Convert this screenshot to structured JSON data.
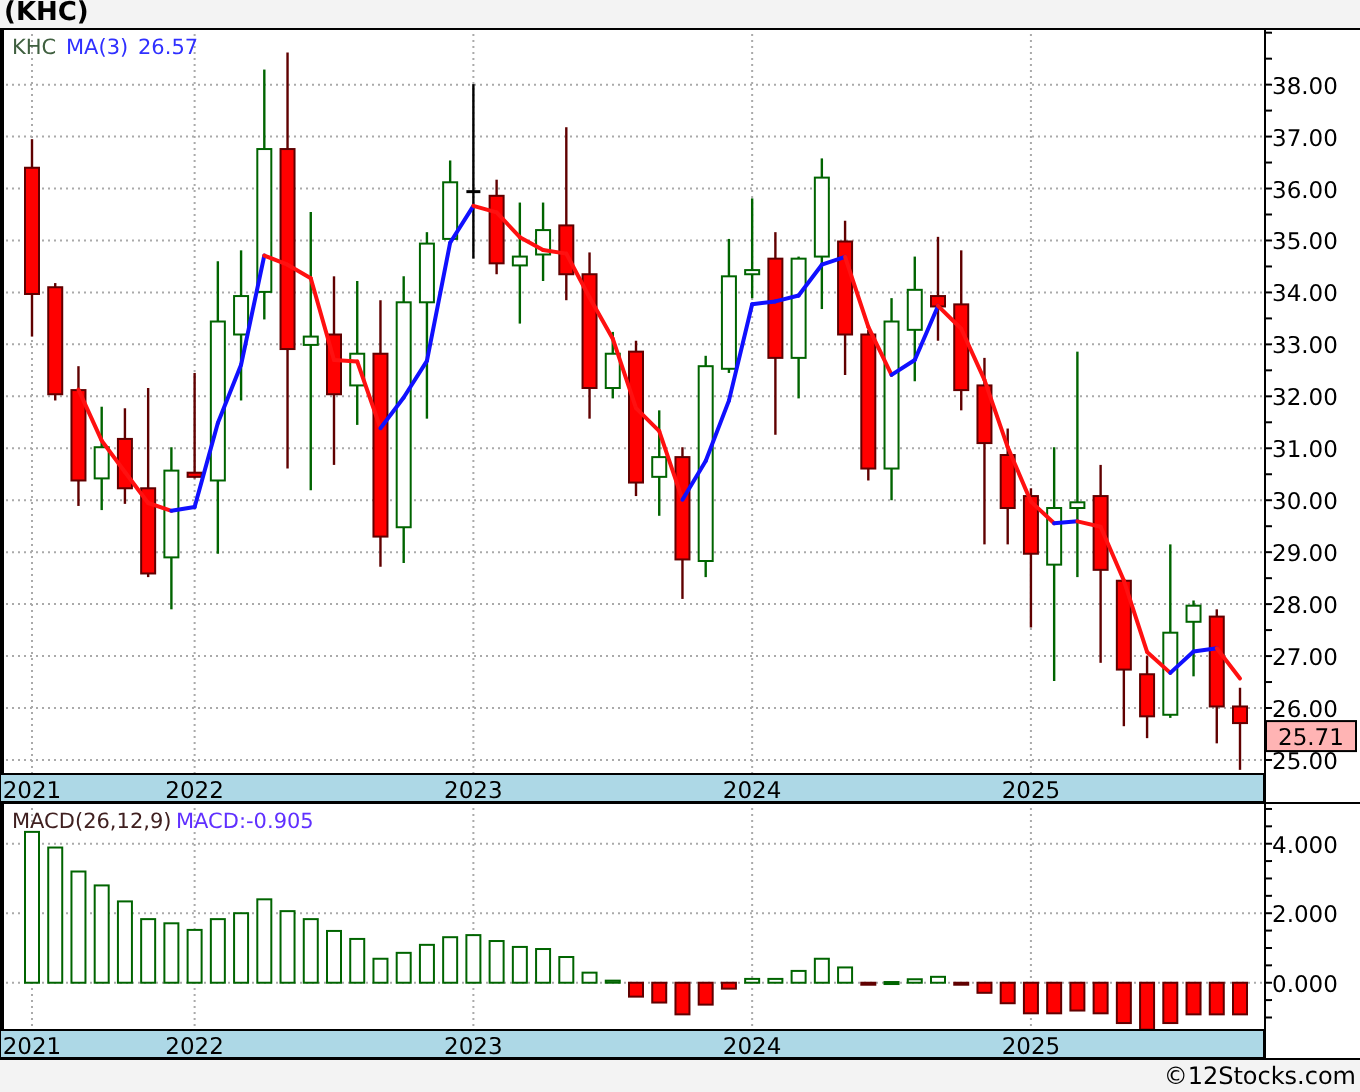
{
  "title": "(KHC)",
  "price_chart": {
    "legend": {
      "symbol": "KHC",
      "indicator": "MA(3)",
      "value": "26.57"
    },
    "last_price": "25.71",
    "chart_data": {
      "type": "candlestick",
      "ylim": [
        24.73,
        39.09
      ],
      "grid": true,
      "categories": [
        "2021",
        null,
        null,
        null,
        null,
        null,
        null,
        "2022",
        null,
        null,
        null,
        null,
        null,
        null,
        null,
        null,
        null,
        null,
        null,
        "2023",
        null,
        null,
        null,
        null,
        null,
        null,
        null,
        null,
        null,
        null,
        null,
        "2024",
        null,
        null,
        null,
        null,
        null,
        null,
        null,
        null,
        null,
        null,
        null,
        "2025",
        null,
        null,
        null,
        null,
        null,
        null,
        null,
        null,
        null
      ],
      "yticks": [
        {
          "value": 25,
          "label": "25.00"
        },
        {
          "value": 26,
          "label": "26.00"
        },
        {
          "value": 27,
          "label": "27.00"
        },
        {
          "value": 28,
          "label": "28.00"
        },
        {
          "value": 29,
          "label": "29.00"
        },
        {
          "value": 30,
          "label": "30.00"
        },
        {
          "value": 31,
          "label": "31.00"
        },
        {
          "value": 32,
          "label": "32.00"
        },
        {
          "value": 33,
          "label": "33.00"
        },
        {
          "value": 34,
          "label": "34.00"
        },
        {
          "value": 35,
          "label": "35.00"
        },
        {
          "value": 36,
          "label": "36.00"
        },
        {
          "value": 37,
          "label": "37.00"
        },
        {
          "value": 38,
          "label": "38.00"
        }
      ],
      "ohlc": [
        [
          36.4,
          36.95,
          33.15,
          33.97
        ],
        [
          34.1,
          34.18,
          31.92,
          32.04
        ],
        [
          32.12,
          32.58,
          29.89,
          30.38
        ],
        [
          30.42,
          31.8,
          29.81,
          31.02
        ],
        [
          31.18,
          31.77,
          29.93,
          30.23
        ],
        [
          30.23,
          32.16,
          28.52,
          28.59
        ],
        [
          28.9,
          31.02,
          27.9,
          30.57
        ],
        [
          30.53,
          32.45,
          30.42,
          30.45
        ],
        [
          30.38,
          34.6,
          28.97,
          33.44
        ],
        [
          33.19,
          34.81,
          31.92,
          33.93
        ],
        [
          34.01,
          38.29,
          33.48,
          36.76
        ],
        [
          36.76,
          38.62,
          30.61,
          32.91
        ],
        [
          32.99,
          35.55,
          30.19,
          33.15
        ],
        [
          33.19,
          34.31,
          30.68,
          32.04
        ],
        [
          32.21,
          34.22,
          31.45,
          32.82
        ],
        [
          32.82,
          33.85,
          28.72,
          29.3
        ],
        [
          29.48,
          34.31,
          28.79,
          33.81
        ],
        [
          33.81,
          35.16,
          31.57,
          34.94
        ],
        [
          35.03,
          36.54,
          35.03,
          36.12
        ],
        [
          35.94,
          38.01,
          34.65,
          35.94
        ],
        [
          35.86,
          36.17,
          34.35,
          34.56
        ],
        [
          34.52,
          35.73,
          33.4,
          34.69
        ],
        [
          34.73,
          35.73,
          34.22,
          35.2
        ],
        [
          35.29,
          37.18,
          33.85,
          34.35
        ],
        [
          34.35,
          34.77,
          31.57,
          32.16
        ],
        [
          32.16,
          33.24,
          31.96,
          32.82
        ],
        [
          32.86,
          33.07,
          30.08,
          30.34
        ],
        [
          30.45,
          31.73,
          29.7,
          30.83
        ],
        [
          30.83,
          31.02,
          28.1,
          28.86
        ],
        [
          28.83,
          32.78,
          28.52,
          32.58
        ],
        [
          32.53,
          35.03,
          32.45,
          34.31
        ],
        [
          34.35,
          35.81,
          33.89,
          34.43
        ],
        [
          34.65,
          35.16,
          31.26,
          32.74
        ],
        [
          32.74,
          34.69,
          31.96,
          34.65
        ],
        [
          34.69,
          36.58,
          33.68,
          36.21
        ],
        [
          34.98,
          35.38,
          32.41,
          33.19
        ],
        [
          33.19,
          33.28,
          30.38,
          30.61
        ],
        [
          30.61,
          33.89,
          30.0,
          33.44
        ],
        [
          33.28,
          34.69,
          32.29,
          34.05
        ],
        [
          33.93,
          35.07,
          33.07,
          33.73
        ],
        [
          33.77,
          34.81,
          31.73,
          32.12
        ],
        [
          32.21,
          32.74,
          29.15,
          31.1
        ],
        [
          30.87,
          31.38,
          29.15,
          29.85
        ],
        [
          30.08,
          30.23,
          27.55,
          28.97
        ],
        [
          28.76,
          31.02,
          26.52,
          29.85
        ],
        [
          29.85,
          32.86,
          28.52,
          29.96
        ],
        [
          30.08,
          30.68,
          26.87,
          28.66
        ],
        [
          28.45,
          28.45,
          25.65,
          26.74
        ],
        [
          26.65,
          27.0,
          25.42,
          25.84
        ],
        [
          25.87,
          29.15,
          25.81,
          27.45
        ],
        [
          27.66,
          28.07,
          26.61,
          27.97
        ],
        [
          27.76,
          27.9,
          25.32,
          26.03
        ],
        [
          26.03,
          26.39,
          24.81,
          25.71
        ]
      ]
    }
  },
  "macd_chart": {
    "legend": {
      "name": "MACD(26,12,9)",
      "value": "MACD:-0.905"
    },
    "chart_data": {
      "type": "bar",
      "ylim": [
        -1.36,
        5.2
      ],
      "grid": true,
      "categories": [
        "2021",
        null,
        null,
        null,
        null,
        null,
        null,
        "2022",
        null,
        null,
        null,
        null,
        null,
        null,
        null,
        null,
        null,
        null,
        null,
        "2023",
        null,
        null,
        null,
        null,
        null,
        null,
        null,
        null,
        null,
        null,
        null,
        "2024",
        null,
        null,
        null,
        null,
        null,
        null,
        null,
        null,
        null,
        null,
        null,
        "2025",
        null,
        null,
        null,
        null,
        null,
        null,
        null,
        null,
        null
      ],
      "yticks": [
        {
          "value": 0,
          "label": "0.000"
        },
        {
          "value": 2,
          "label": "2.000"
        },
        {
          "value": 4,
          "label": "4.000"
        }
      ],
      "series": [
        {
          "values": [
            4.34,
            3.89,
            3.2,
            2.8,
            2.34,
            1.83,
            1.71,
            1.52,
            1.83,
            2.0,
            2.4,
            2.06,
            1.83,
            1.49,
            1.26,
            0.69,
            0.86,
            1.09,
            1.31,
            1.37,
            1.2,
            1.03,
            0.97,
            0.74,
            0.29,
            0.06,
            -0.4,
            -0.57,
            -0.91,
            -0.63,
            -0.17,
            0.11,
            0.11,
            0.34,
            0.69,
            0.44,
            -0.05,
            0.02,
            0.1,
            0.17,
            -0.05,
            -0.29,
            -0.59,
            -0.88,
            -0.88,
            -0.8,
            -0.88,
            -1.16,
            -1.35,
            -1.16,
            -0.91,
            -0.91,
            -0.91
          ]
        }
      ]
    }
  },
  "footer": "©12Stocks.com"
}
